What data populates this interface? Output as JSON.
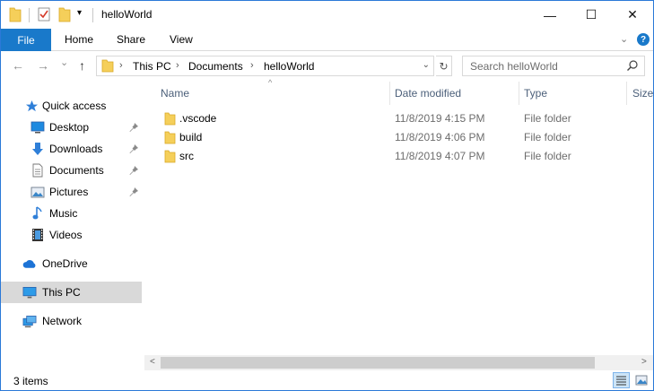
{
  "window": {
    "title": "helloWorld",
    "minimize_glyph": "—",
    "maximize_glyph": "☐",
    "close_glyph": "✕"
  },
  "quick_access_toolbar": {
    "icons": [
      "folder-icon",
      "properties-checkmark-icon",
      "new-folder-icon",
      "customize-dropdown-icon"
    ],
    "dropdown_glyph": "▾"
  },
  "ribbon": {
    "file_label": "File",
    "tabs": [
      "Home",
      "Share",
      "View"
    ],
    "expand_glyph": "⌄",
    "help_glyph": "?"
  },
  "navigation": {
    "back_glyph": "←",
    "forward_glyph": "→",
    "recent_glyph": "⌄",
    "up_glyph": "↑",
    "breadcrumb": [
      "This PC",
      "Documents",
      "helloWorld"
    ],
    "separator_glyph": "›",
    "address_dropdown_glyph": "⌄",
    "refresh_glyph": "↻",
    "search_placeholder": "Search helloWorld"
  },
  "sidebar": {
    "items": [
      {
        "label": "Quick access",
        "icon": "star-icon",
        "pinned": false
      },
      {
        "label": "Desktop",
        "icon": "desktop-icon",
        "pinned": true
      },
      {
        "label": "Downloads",
        "icon": "download-arrow-icon",
        "pinned": true
      },
      {
        "label": "Documents",
        "icon": "documents-icon",
        "pinned": true
      },
      {
        "label": "Pictures",
        "icon": "pictures-icon",
        "pinned": true
      },
      {
        "label": "Music",
        "icon": "music-note-icon",
        "pinned": false
      },
      {
        "label": "Videos",
        "icon": "video-film-icon",
        "pinned": false
      },
      {
        "label": "OneDrive",
        "icon": "cloud-icon",
        "pinned": false
      },
      {
        "label": "This PC",
        "icon": "computer-icon",
        "pinned": false,
        "selected": true
      },
      {
        "label": "Network",
        "icon": "network-icon",
        "pinned": false
      }
    ]
  },
  "file_list": {
    "columns": [
      "Name",
      "Date modified",
      "Type",
      "Size"
    ],
    "sort_glyph": "^",
    "rows": [
      {
        "name": ".vscode",
        "date": "11/8/2019 4:15 PM",
        "type": "File folder"
      },
      {
        "name": "build",
        "date": "11/8/2019 4:06 PM",
        "type": "File folder"
      },
      {
        "name": "src",
        "date": "11/8/2019 4:07 PM",
        "type": "File folder"
      }
    ]
  },
  "scrollbar": {
    "left_glyph": "<",
    "right_glyph": ">"
  },
  "status": {
    "item_count": "3 items",
    "view_buttons": [
      "details-view-icon",
      "large-icons-view-icon"
    ]
  },
  "colors": {
    "accent": "#1979ca",
    "folder": "#f5cf5a",
    "selected": "#d9d9d9"
  }
}
